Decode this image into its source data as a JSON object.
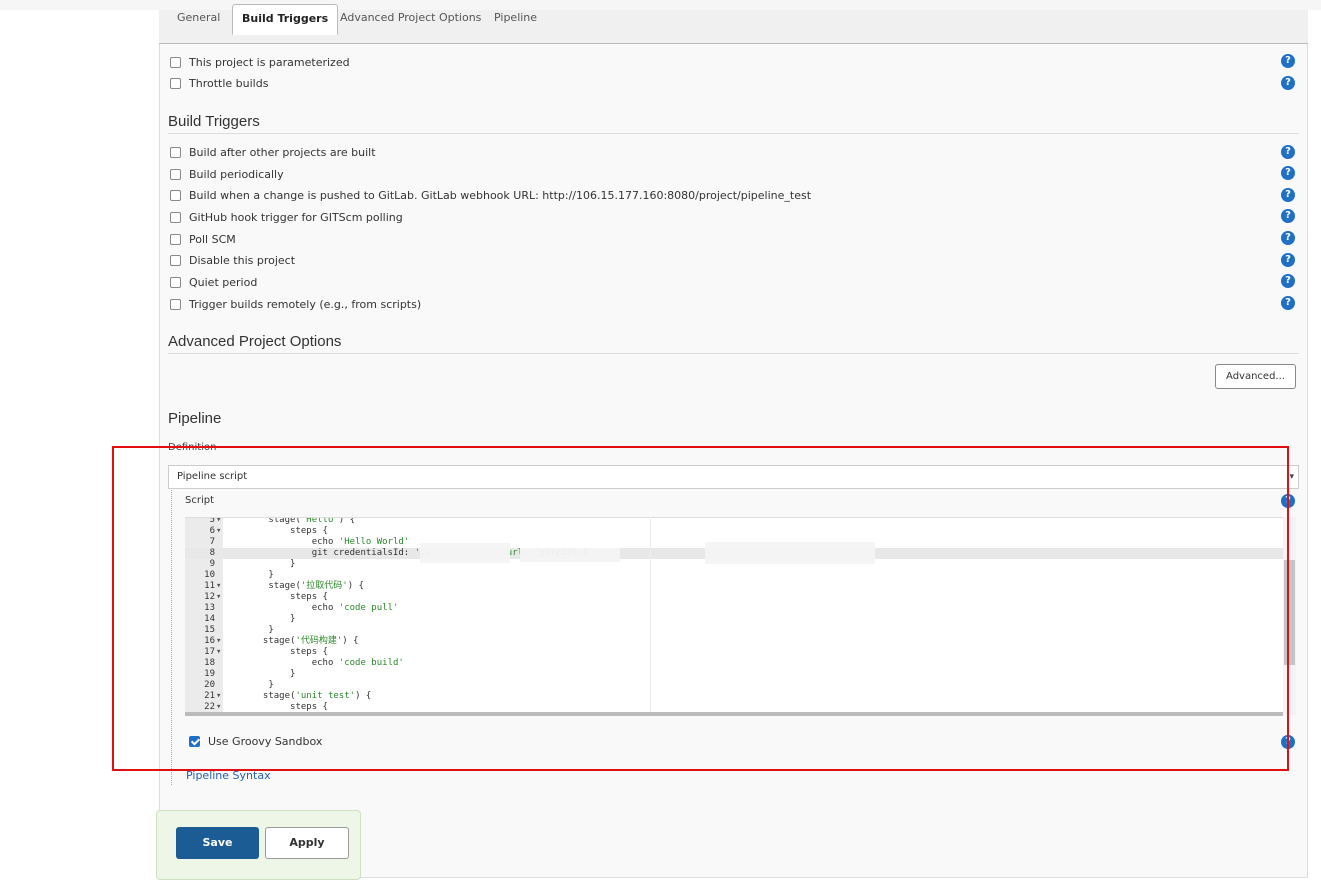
{
  "tabs": [
    "General",
    "Build Triggers",
    "Advanced Project Options",
    "Pipeline"
  ],
  "general_options": [
    "This project is parameterized",
    "Throttle builds"
  ],
  "build_triggers": {
    "title": "Build Triggers",
    "options": [
      "Build after other projects are built",
      "Build periodically",
      "Build when a change is pushed to GitLab. GitLab webhook URL: http://106.15.177.160:8080/project/pipeline_test",
      "GitHub hook trigger for GITScm polling",
      "Poll SCM",
      "Disable this project",
      "Quiet period",
      "Trigger builds remotely (e.g., from scripts)"
    ]
  },
  "advanced": {
    "title": "Advanced Project Options",
    "button": "Advanced..."
  },
  "pipeline": {
    "title": "Pipeline",
    "definition_label": "Definition",
    "definition_value": "Pipeline script",
    "script_label": "Script",
    "code": [
      {
        "n": "5",
        "fold": "▾",
        "text": "        stage('Hello') {"
      },
      {
        "n": "6",
        "fold": "▾",
        "text": "            steps {"
      },
      {
        "n": "7",
        "fold": "",
        "text": "                echo 'Hello World'"
      },
      {
        "n": "8",
        "fold": "",
        "text": "                git credentialsId: 'fe              url: 'git@139.1"
      },
      {
        "n": "9",
        "fold": "",
        "text": "            }"
      },
      {
        "n": "10",
        "fold": "",
        "text": "        }"
      },
      {
        "n": "11",
        "fold": "▾",
        "text": "        stage('拉取代码') {"
      },
      {
        "n": "12",
        "fold": "▾",
        "text": "            steps {"
      },
      {
        "n": "13",
        "fold": "",
        "text": "                echo 'code pull'"
      },
      {
        "n": "14",
        "fold": "",
        "text": "            }"
      },
      {
        "n": "15",
        "fold": "",
        "text": "        }"
      },
      {
        "n": "16",
        "fold": "▾",
        "text": "       stage('代码构建') {"
      },
      {
        "n": "17",
        "fold": "▾",
        "text": "            steps {"
      },
      {
        "n": "18",
        "fold": "",
        "text": "                echo 'code build'"
      },
      {
        "n": "19",
        "fold": "",
        "text": "            }"
      },
      {
        "n": "20",
        "fold": "",
        "text": "        }"
      },
      {
        "n": "21",
        "fold": "▾",
        "text": "       stage('unit test') {"
      },
      {
        "n": "22",
        "fold": "▾",
        "text": "            steps {"
      }
    ],
    "sandbox_label": "Use Groovy Sandbox",
    "syntax_link": "Pipeline Syntax"
  },
  "footer": {
    "save": "Save",
    "apply": "Apply"
  },
  "colors": {
    "accent": "#1f6fc5",
    "save_bg": "#1b5c94",
    "annotation": "#e10f0f"
  }
}
